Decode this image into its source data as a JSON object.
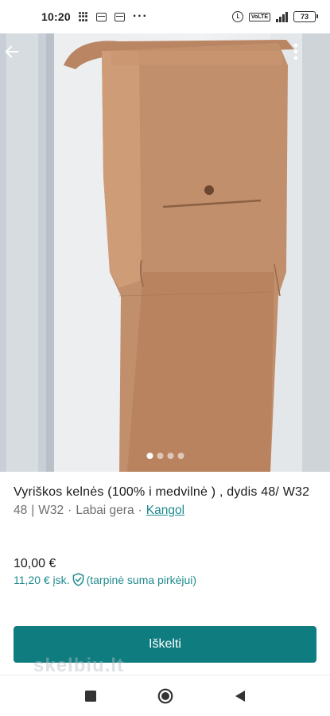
{
  "status_bar": {
    "time": "10:20",
    "battery": "73"
  },
  "listing": {
    "title": "Vyriškos kelnės  (100% i medvilnė ) , dydis 48/ W32",
    "size": "48",
    "size_separator": "|",
    "waist": "W32",
    "condition": "Labai gera",
    "brand": "Kangol",
    "price": "10,00 €",
    "price_incl": "11,20 € įsk.",
    "buyer_protection": "(tarpinė suma pirkėjui)",
    "image_count": 4,
    "active_image": 1
  },
  "actions": {
    "promote_label": "Iškelti"
  },
  "watermark": "skelbiu.lt",
  "icons": {
    "back": "arrow-left-icon",
    "more": "more-vertical-icon",
    "shield": "shield-check-icon",
    "nav_recent": "square-icon",
    "nav_home": "circle-icon",
    "nav_back": "triangle-back-icon"
  },
  "colors": {
    "accent": "#1f8a8d",
    "button": "#0f7c80",
    "product": "#c18f6c"
  }
}
